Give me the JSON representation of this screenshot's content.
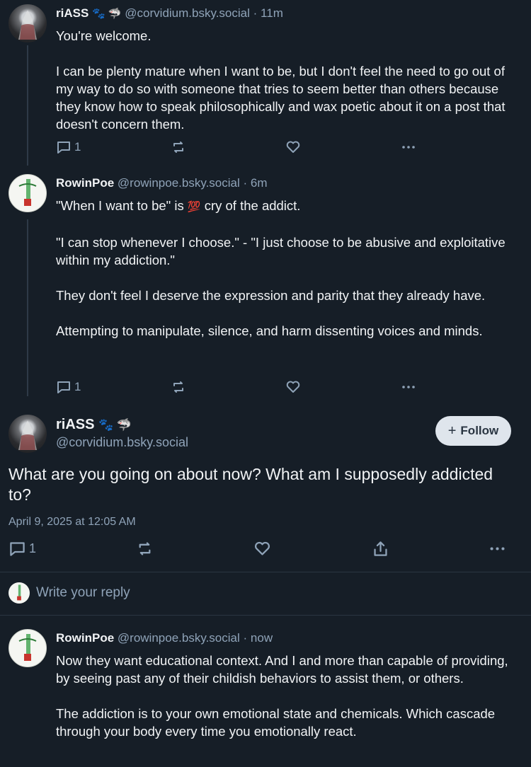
{
  "posts": [
    {
      "name": "riASS",
      "badges": "🐾 🦈",
      "handle": "@corvidium.bsky.social",
      "dot": "·",
      "time": "11m",
      "paragraphs": [
        "You're welcome.",
        "I can be plenty mature when I want to be, but I don't feel the need to go out of my way to do so with someone that tries to seem better than others because they know how to speak philosophically and wax poetic about it on a post that doesn't concern them."
      ],
      "reply_count": "1"
    },
    {
      "name": "RowinPoe",
      "handle": "@rowinpoe.bsky.social",
      "dot": "·",
      "time": "6m",
      "p1_before": "\"When I want to be\" is ",
      "p1_emoji": "💯",
      "p1_after": " cry of the addict.",
      "paragraphs": [
        "\"I can stop whenever I choose.\" - \"I just choose to be abusive and exploitative within my addiction.\"",
        "They don't feel I deserve the expression and parity that they already have.",
        "Attempting to manipulate, silence, and harm dissenting voices and minds."
      ],
      "reply_count": "1"
    }
  ],
  "focus": {
    "name": "riASS",
    "badges": "🐾 🦈",
    "handle": "@corvidium.bsky.social",
    "follow_label": "Follow",
    "text": "What are you going on about now? What am I supposedly addicted to?",
    "date": "April 9, 2025 at 12:05 AM",
    "reply_count": "1"
  },
  "reply_box": {
    "placeholder": "Write your reply"
  },
  "last_post": {
    "name": "RowinPoe",
    "handle": "@rowinpoe.bsky.social",
    "dot": "·",
    "time": "now",
    "paragraphs": [
      "Now they want educational context. And I and more than capable of providing, by seeing past any of their childish behaviors to assist them, or others.",
      "The addiction is to your own emotional state and chemicals. Which cascade through your body every time you emotionally react."
    ]
  },
  "colors": {
    "background": "#161e27",
    "muted": "#8fa3b8",
    "follow_bg": "#dfe5ec"
  }
}
